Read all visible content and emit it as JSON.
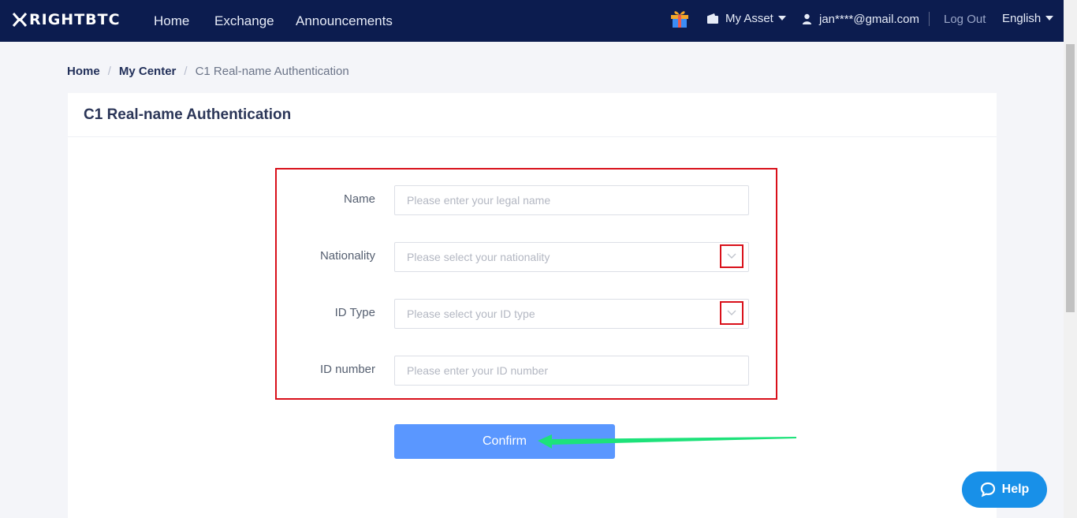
{
  "header": {
    "logo_text": "RIGHTBTC",
    "nav": [
      "Home",
      "Exchange",
      "Announcements"
    ],
    "asset_label": "My Asset",
    "user_email": "jan****@gmail.com",
    "logout_label": "Log Out",
    "language": "English"
  },
  "breadcrumb": {
    "home": "Home",
    "center": "My Center",
    "current": "C1 Real-name Authentication",
    "separator": "/"
  },
  "card": {
    "title": "C1 Real-name Authentication"
  },
  "form": {
    "name_label": "Name",
    "name_placeholder": "Please enter your legal name",
    "nationality_label": "Nationality",
    "nationality_placeholder": "Please select your nationality",
    "idtype_label": "ID Type",
    "idtype_placeholder": "Please select your ID type",
    "idnumber_label": "ID number",
    "idnumber_placeholder": "Please enter your ID number",
    "confirm_label": "Confirm"
  },
  "help": {
    "label": "Help"
  },
  "colors": {
    "header_bg": "#0c1c4f",
    "primary_button": "#5a97ff",
    "annotation_red": "#d9101a",
    "annotation_arrow": "#1de27a",
    "help_button": "#1890e8"
  },
  "icons": [
    "logo-icon",
    "gift-icon",
    "wallet-icon",
    "user-icon",
    "chevron-down-icon",
    "chat-bubble-icon",
    "arrow-annotation"
  ]
}
